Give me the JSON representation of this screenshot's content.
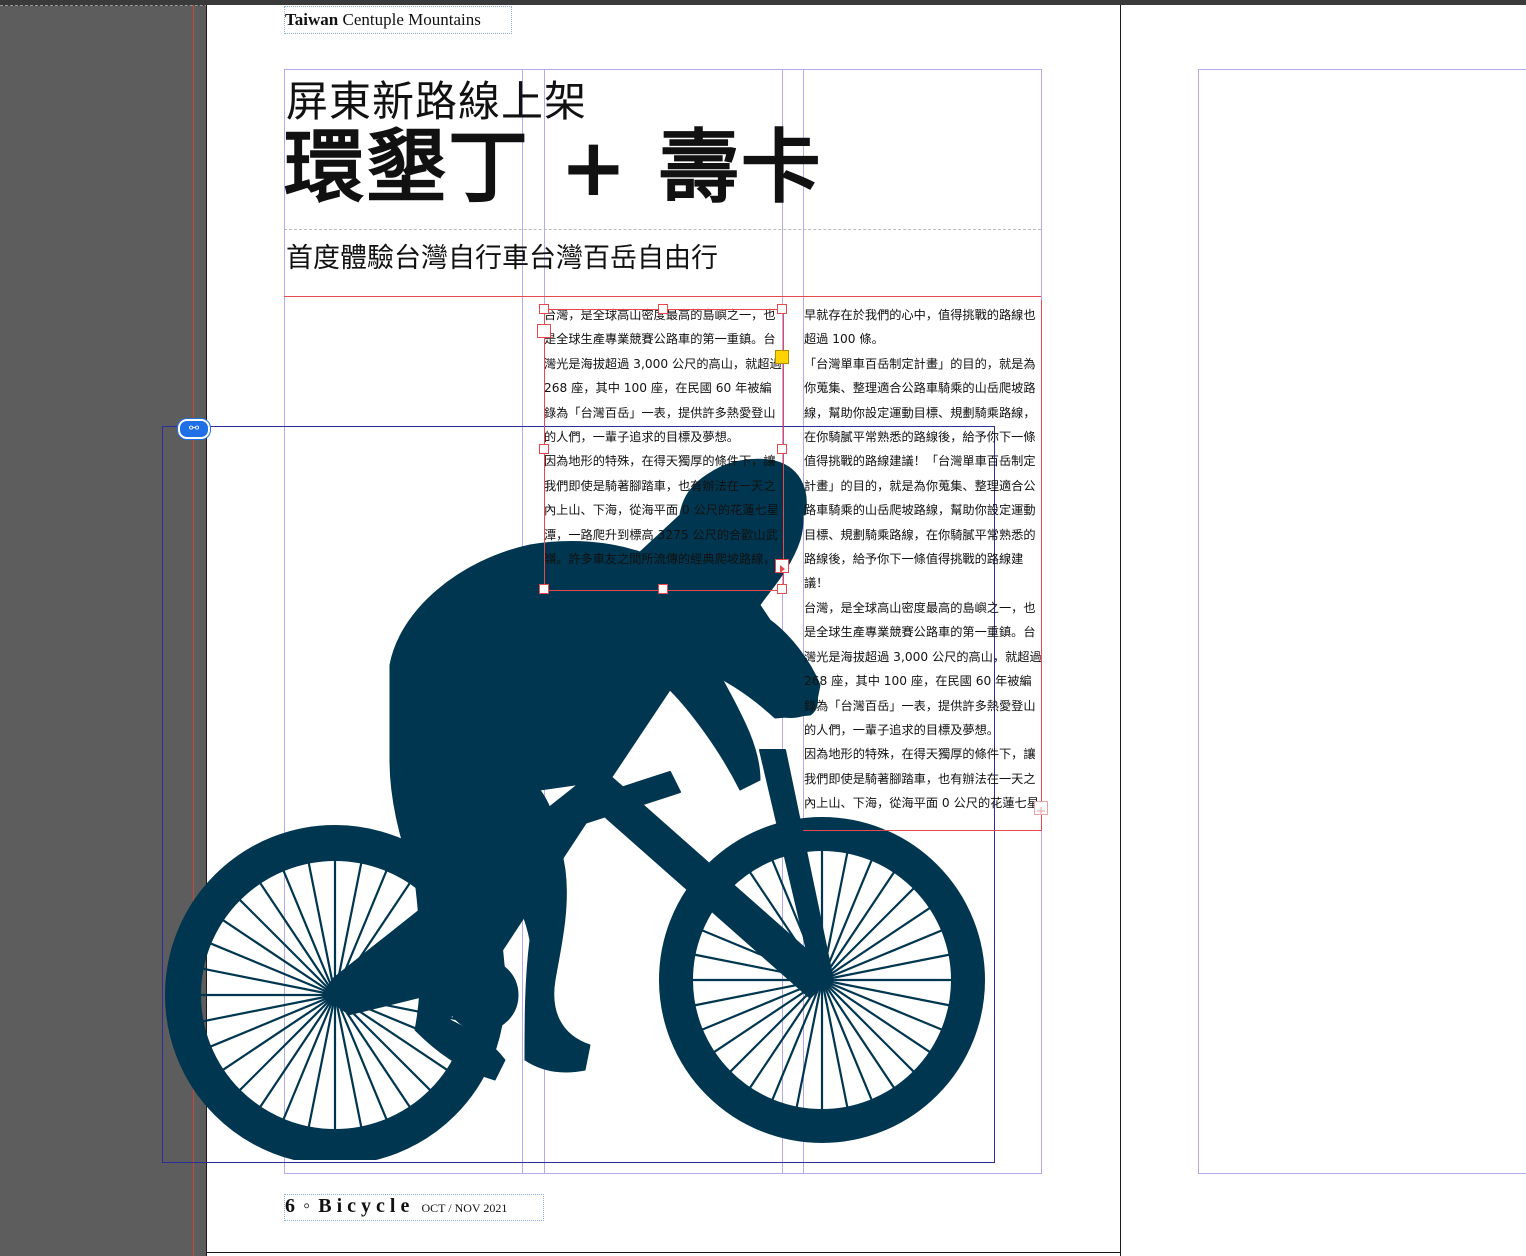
{
  "document": {
    "header": {
      "bold": "Taiwan",
      "rest": " Centuple Mountains"
    },
    "title_line_1": "屏東新路線上架",
    "title_line_2": "環墾丁 + 壽卡",
    "subtitle": "首度體驗台灣自行車台灣百岳自由行",
    "column_1_paragraphs": [
      "台灣，是全球高山密度最高的島嶼之一，也是全球生產專業競賽公路車的第一重鎮。台灣光是海拔超過 3,000 公尺的高山，就超過 268 座，其中 100 座，在民國 60 年被編錄為「台灣百岳」一表，提供許多熱愛登山的人們，一輩子追求的目標及夢想。",
      "因為地形的特殊，在得天獨厚的條件下，讓我們即使是騎著腳踏車，也有辦法在一天之內上山、下海，從海平面 0 公尺的花蓮七星潭，一路爬升到標高 3275 公尺的合歡山武嶺。許多車友之間所流傳的經典爬坡路線，"
    ],
    "column_2_paragraphs": [
      "早就存在於我們的心中，值得挑戰的路線也超過 100 條。",
      "「台灣單車百岳制定計畫」的目的，就是為你蒐集、整理適合公路車騎乘的山岳爬坡路線，幫助你設定運動目標、規劃騎乘路線，在你騎膩平常熟悉的路線後，給予你下一條值得挑戰的路線建議！「台灣單車百岳制定計畫」的目的，就是為你蒐集、整理適合公路車騎乘的山岳爬坡路線，幫助你設定運動目標、規劃騎乘路線，在你騎膩平常熟悉的路線後，給予你下一條值得挑戰的路線建議！",
      "台灣，是全球高山密度最高的島嶼之一，也是全球生產專業競賽公路車的第一重鎮。台灣光是海拔超過 3,000 公尺的高山，就超過 268 座，其中 100 座，在民國 60 年被編錄為「台灣百岳」一表，提供許多熱愛登山的人們，一輩子追求的目標及夢想。",
      "因為地形的特殊，在得天獨厚的條件下，讓我們即使是騎著腳踏車，也有辦法在一天之內上山、下海，從海平面 0 公尺的花蓮七星"
    ],
    "footer": {
      "page_number": "6",
      "separator": "◦",
      "brand": "Bicycle",
      "date": "OCT / NOV 2021"
    }
  },
  "colors": {
    "silhouette": "#003650",
    "frame_red": "#e5484d",
    "guide_purple": "#b8a8f0",
    "link_blue": "#1f6fe6",
    "pasteboard": "#5d5d5d"
  },
  "icons": {
    "link": "link-icon",
    "overset": "overset-text-icon",
    "outport": "text-outport-arrow-icon"
  }
}
